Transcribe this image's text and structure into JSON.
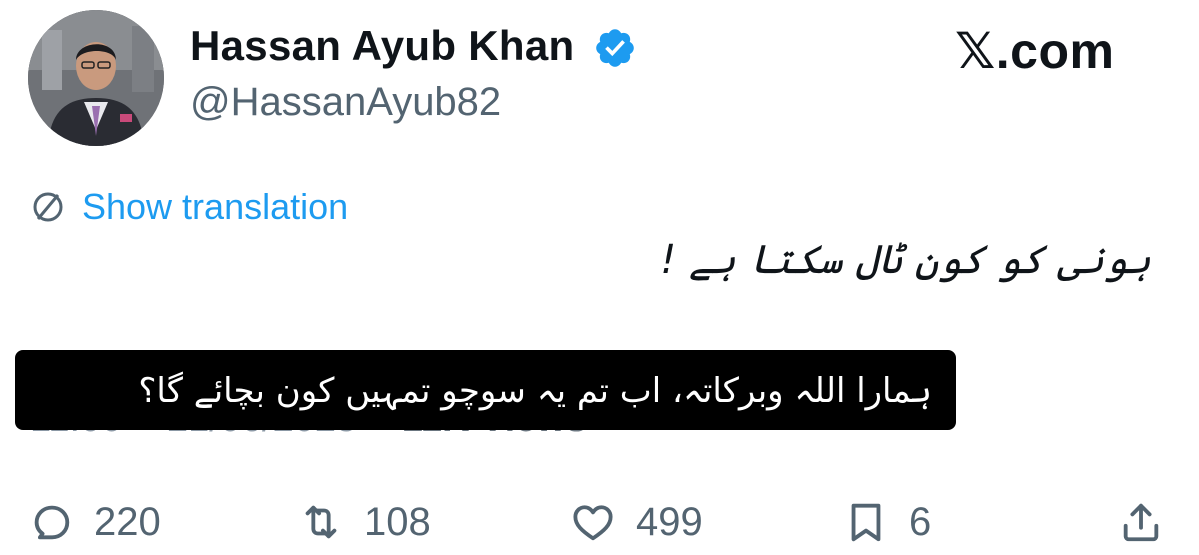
{
  "author": {
    "display_name": "Hassan Ayub Khan",
    "handle": "@HassanAyub82",
    "verified": true
  },
  "site_logo": "𝕏.com",
  "translate_label": "Show translation",
  "tweet_text": "ہونی کو کون ٹال سکتا ہے !",
  "meta": {
    "time": "11:00",
    "date": "21/06/2025",
    "views": "11K Views"
  },
  "caption": "ہمارا اللہ وبرکاتہ، اب تم یہ سوچو تمہیں کون بچائے گا؟",
  "actions": {
    "replies": "220",
    "reposts": "108",
    "likes": "499",
    "bookmarks": "6"
  },
  "colors": {
    "link_blue": "#1d9bf0",
    "muted_gray": "#536471",
    "caption_bg": "#000000"
  }
}
